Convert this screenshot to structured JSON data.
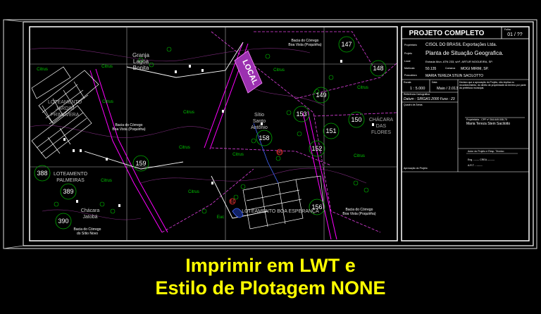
{
  "map": {
    "labels": {
      "local": "LOCAL",
      "granja": [
        "Granja",
        "Lagoa",
        "Bonita"
      ],
      "loteamento_jd": [
        "LOTEAMENTO",
        "JARDIM",
        "PRIMAVERA"
      ],
      "loteamento_palmeiras": [
        "LOTEAMENTO",
        "PALMEIRAS"
      ],
      "loteamento_boa_esperanca": "LOTEAMENTO BOA ESPERANÇA",
      "sitio_santo_antonio": [
        "Sítio",
        "Santo",
        "Antônio"
      ],
      "chacara_das_flores": [
        "CHÁCARA",
        "DAS",
        "FLORES"
      ],
      "chacara_jatoba": [
        "Chácara",
        "Jatobá"
      ],
      "bacia_top": [
        "Bacia do Córrego",
        "Boa Vista (Poquiirha)"
      ],
      "bacia_mid": [
        "Bacia do Córrego",
        "Boa Vista (Poquiirha)"
      ],
      "bacia_right": [
        "Bacia do Córrego",
        "Boa Vista (Poquiirha)"
      ],
      "bacia_sitio_novo": [
        "Bacia do Córrego",
        "do Sítio Novo"
      ],
      "citrus": "Citrus",
      "eucalipto": "Euc"
    },
    "lots": [
      "147",
      "148",
      "149",
      "153",
      "150",
      "151",
      "152",
      "158",
      "159",
      "388",
      "389",
      "390",
      "156"
    ],
    "markers": [
      "60",
      "61"
    ]
  },
  "title_block": {
    "heading": "PROJETO COMPLETO",
    "folha_label": "Folha",
    "folha_value": "01 / ??",
    "proprietario_label": "Proprietário",
    "proprietario_value": "CISOL DO BRASIL Exportações Ltda.",
    "projeto_label": "Projeto",
    "projeto_value": "Planta de Situação Geografica.",
    "local_label": "Local",
    "local_value": "Estrada Mun. ATN 233, s/nº, ARTUR NOGUEIRA, SP.",
    "matricula_label": "Matrícula",
    "matricula_value": "50.135",
    "comarca_label": "Comarca",
    "comarca_value": "MOGI MIRIM, SP.",
    "possuidora_label": "Possuidora",
    "possuidora_value": "MARIA TEREZA STEIN SACILOTTO",
    "escala_label": "Escala",
    "escala_value": "1 : 5.000",
    "data_label": "Data",
    "data_value": "Maio / 2.013",
    "ref_label": "Referência Cartográfica",
    "datum_value": "Datum : SIRGAS 2000  Fuso : 23",
    "quadro_label": "Quadro de Áreas",
    "declaro_text": "Declaro que a aprovação do Projeto, não implica no reconhecimento, do direito de propriedade do terreno por parte da prefeitura municipal.",
    "proprietaria_line": "Proprietária - CPF nº 264.649.008-70",
    "proprietaria_name": "Maria Tereza Stein Sacilotto",
    "autor_label": "Autor do Projeto e Resp. Técnico",
    "eng_label": "Eng. ------- CREA ---------",
    "art_label": "A.R.T. - -------",
    "aprovacao_label": "Aprovação do Projeto"
  },
  "caption": {
    "line1": "Imprimir em LWT e",
    "line2": "Estilo de Plotagem NONE"
  },
  "colors": {
    "background": "#000000",
    "caption": "#ffff00",
    "road": "#ff00ff",
    "boundary": "#ffffff",
    "vegetation": "#00cc00",
    "lot_circle": "#00aa00",
    "grid": "#c0c0c0",
    "local_highlight": "#9b30b0"
  }
}
